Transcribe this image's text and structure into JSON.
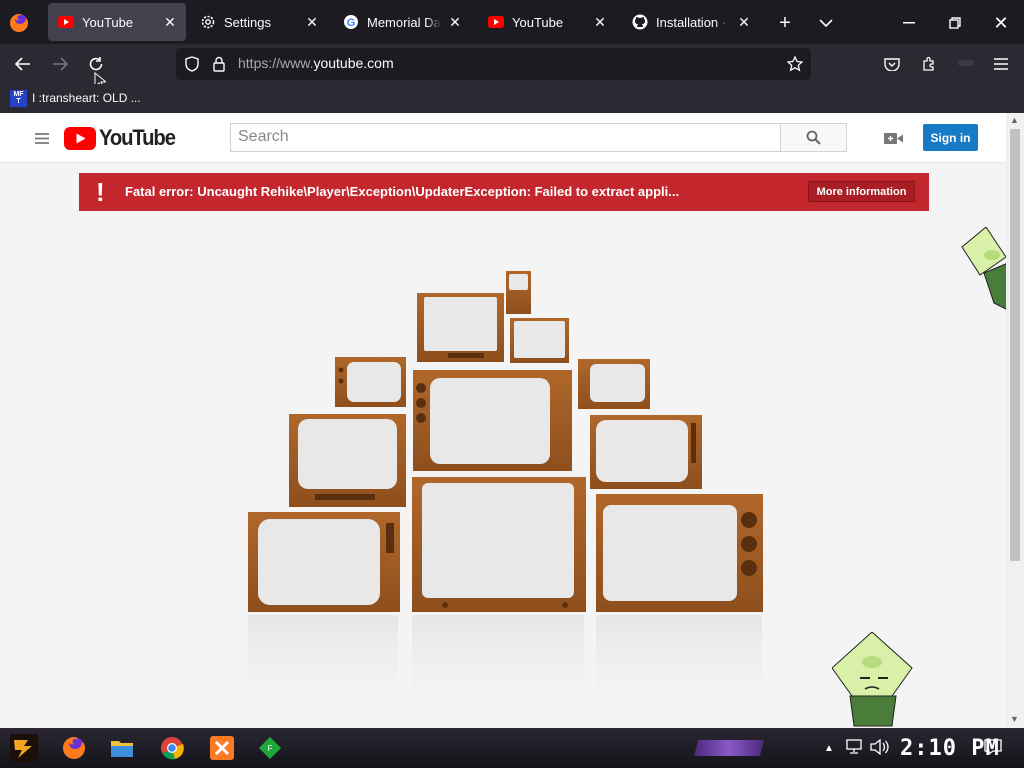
{
  "browser": {
    "tabs": [
      {
        "title": "YouTube",
        "favicon": "youtube-icon",
        "active": true
      },
      {
        "title": "Settings",
        "favicon": "gear-icon",
        "active": false
      },
      {
        "title": "Memorial Day -",
        "favicon": "google-icon",
        "active": false
      },
      {
        "title": "YouTube",
        "favicon": "youtube-icon",
        "active": false
      },
      {
        "title": "Installation · Re",
        "favicon": "github-icon",
        "active": false
      }
    ],
    "url_prefix": "https://www.",
    "url_domain": "youtube.com",
    "bookmarks": [
      {
        "icon_text": "MF T",
        "label": "I :transheart: OLD ..."
      }
    ]
  },
  "youtube": {
    "logo_text": "YouTube",
    "search_placeholder": "Search",
    "signin_label": "Sign in",
    "error": {
      "icon": "!",
      "message": "Fatal error: Uncaught Rehike\\Player\\Exception\\UpdaterException: Failed to extract appli...",
      "more_label": "More information"
    }
  },
  "taskbar": {
    "time": "2:10 PM",
    "apps": [
      "firefox-icon",
      "file-explorer-icon",
      "chrome-icon",
      "xampp-icon",
      "app-icon"
    ]
  },
  "colors": {
    "error_red": "#c4262d",
    "signin_blue": "#167ac6",
    "youtube_red": "#ff0000",
    "browser_dark": "#1c1b22"
  }
}
